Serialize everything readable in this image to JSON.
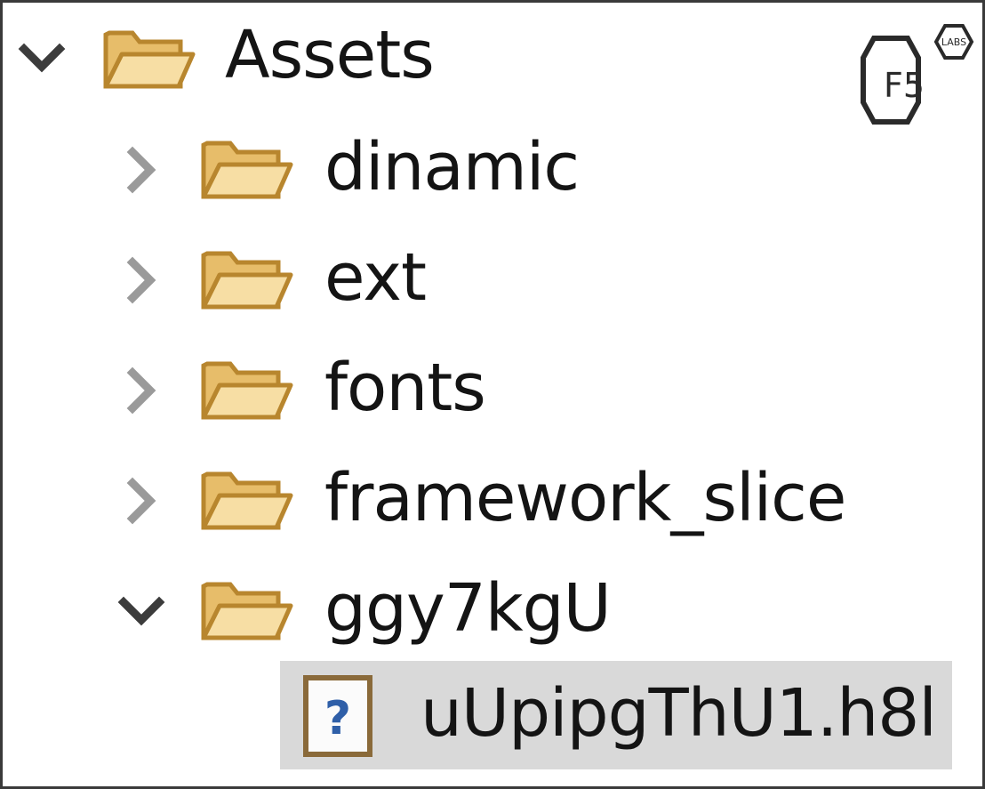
{
  "tree": {
    "root": {
      "label": "Assets",
      "expanded": true
    },
    "children": [
      {
        "label": "dinamic",
        "expanded": false
      },
      {
        "label": "ext",
        "expanded": false
      },
      {
        "label": "fonts",
        "expanded": false
      },
      {
        "label": "framework_slice",
        "expanded": false
      },
      {
        "label": "ggy7kgU",
        "expanded": true
      }
    ],
    "file": {
      "label": "uUpipgThU1.h8l",
      "icon": "unknown-file-icon",
      "selected": true
    }
  },
  "watermark": {
    "brand": "F5",
    "sub": "LABS"
  },
  "colors": {
    "folder_fill": "#f3d493",
    "folder_stroke": "#b8862e",
    "chevron_collapsed": "#9a9a9a",
    "chevron_expanded": "#3c3c3c",
    "selection": "#d9d9d9",
    "text": "#141414"
  }
}
